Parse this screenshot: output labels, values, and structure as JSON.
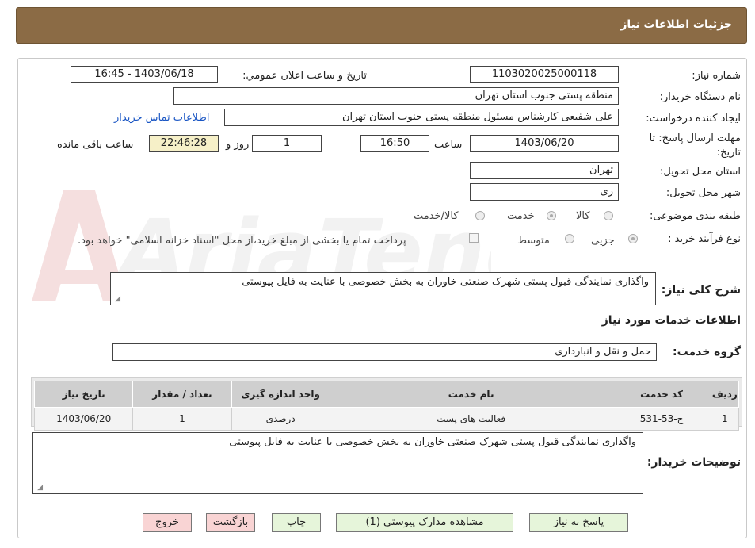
{
  "header": {
    "title": "جزئیات اطلاعات نیاز"
  },
  "form": {
    "need_number": {
      "label": "شماره نیاز:",
      "value": "1103020025000118"
    },
    "announce_datetime": {
      "label": "تاریخ و ساعت اعلان عمومي:",
      "value": "1403/06/18 - 16:45"
    },
    "buyer_org": {
      "label": "نام دستگاه خریدار:",
      "value": "منطقه پستی جنوب استان تهران"
    },
    "requester": {
      "label": "ایجاد کننده درخواست:",
      "value": "علی شفیعی کارشناس مسئول منطقه پستی جنوب استان تهران",
      "contact_link": "اطلاعات تماس خریدار"
    },
    "deadline": {
      "label": "مهلت ارسال پاسخ: تا تاریخ:",
      "date": "1403/06/20",
      "time_label": "ساعت",
      "time": "16:50",
      "days": "1",
      "days_label": "روز و",
      "remaining": "22:46:28",
      "remaining_label": "ساعت باقی مانده"
    },
    "province": {
      "label": "استان محل تحویل:",
      "value": "تهران"
    },
    "city": {
      "label": "شهر محل تحویل:",
      "value": "ری"
    },
    "category": {
      "label": "طبقه بندی موضوعی:",
      "options": [
        "کالا",
        "خدمت",
        "کالا/خدمت"
      ],
      "selected": "خدمت"
    },
    "purchase_type": {
      "label": "نوع فرآیند خرید :",
      "options": [
        "جزیی",
        "متوسط"
      ],
      "selected": "جزیی",
      "payment_note": "پرداخت تمام یا بخشی از مبلغ خرید،از محل \"اسناد خزانه اسلامی\" خواهد بود."
    },
    "description": {
      "label": "شرح کلی نیاز:",
      "value": "واگذاری نمایندگی قبول پستی شهرک صنعتی خاوران به بخش خصوصی با عنایت به فایل پیوستی"
    }
  },
  "services": {
    "title": "اطلاعات خدمات مورد نیاز",
    "group_label": "گروه خدمت:",
    "group_value": "حمل و نقل و انبارداری",
    "table": {
      "headers": [
        "ردیف",
        "کد خدمت",
        "نام خدمت",
        "واحد اندازه گیری",
        "تعداد / مقدار",
        "تاریخ نیاز"
      ],
      "rows": [
        [
          "1",
          "ح-53-531",
          "فعالیت های پست",
          "درصدی",
          "1",
          "1403/06/20"
        ]
      ]
    }
  },
  "buyer_notes": {
    "label": "توضیحات خریدار:",
    "value": "واگذاری نمایندگی قبول پستی شهرک صنعتی خاوران به بخش خصوصی با عنایت به فایل پیوستی"
  },
  "buttons": {
    "reply": "پاسخ به نیاز",
    "attachments": "مشاهده مدارک پیوستي (1)",
    "print": "چاپ",
    "back": "بازگشت",
    "exit": "خروج"
  },
  "watermark": {
    "text": "AriaTender.net"
  }
}
